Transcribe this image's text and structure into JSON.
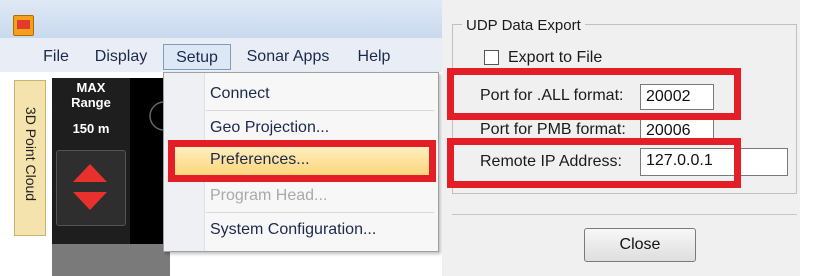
{
  "colors": {
    "callout": "#e41e26",
    "menu_text": "#1c2a4a",
    "highlight": "#fcd57a",
    "panel_dark": "#1e1e1e"
  },
  "window": {
    "app_icon": "app-logo-icon"
  },
  "menubar": {
    "items": [
      "File",
      "Display",
      "Setup",
      "Sonar Apps",
      "Help"
    ],
    "active": "Setup"
  },
  "sidebar": {
    "tab_label": "3D Point Cloud"
  },
  "range_panel": {
    "max_label": "MAX",
    "range_label": "Range",
    "value": "150 m",
    "stepper_icon": "up-down-arrows-icon"
  },
  "setup_menu": {
    "items": [
      {
        "label": "Connect",
        "enabled": true
      },
      {
        "label": "Geo Projection...",
        "enabled": true
      },
      {
        "label": "Preferences...",
        "enabled": true,
        "highlighted": true
      },
      {
        "label": "Program Head...",
        "enabled": false
      },
      {
        "label": "System Configuration...",
        "enabled": true
      }
    ]
  },
  "udp_dialog": {
    "group_title": "UDP Data Export",
    "export_to_file": {
      "label": "Export to File",
      "checked": false
    },
    "fields": [
      {
        "label": "Port for .ALL format:",
        "value": "20002"
      },
      {
        "label": "Port for PMB format:",
        "value": "20006"
      },
      {
        "label": "Remote IP Address:",
        "value": "127.0.0.1"
      }
    ],
    "close_label": "Close"
  }
}
